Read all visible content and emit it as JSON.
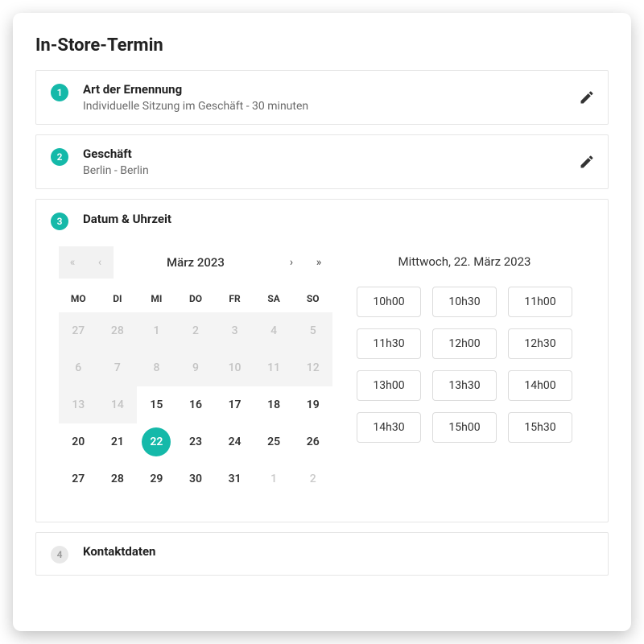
{
  "title": "In-Store-Termin",
  "accent": "#15b9a9",
  "steps": {
    "s1": {
      "num": "1",
      "heading": "Art der Ernennung",
      "sub": "Individuelle Sitzung im Geschäft - 30 minuten"
    },
    "s2": {
      "num": "2",
      "heading": "Geschäft",
      "sub": "Berlin - Berlin"
    },
    "s3": {
      "num": "3",
      "heading": "Datum & Uhrzeit"
    },
    "s4": {
      "num": "4",
      "heading": "Kontaktdaten"
    }
  },
  "calendar": {
    "nav": {
      "first": "«",
      "prev": "‹",
      "next": "›",
      "last": "»"
    },
    "month_label": "März 2023",
    "dow": [
      "MO",
      "DI",
      "MI",
      "DO",
      "FR",
      "SA",
      "SO"
    ],
    "selected_day": "22",
    "rows": [
      [
        {
          "d": "27",
          "t": "muted"
        },
        {
          "d": "28",
          "t": "muted"
        },
        {
          "d": "1",
          "t": "muted"
        },
        {
          "d": "2",
          "t": "muted"
        },
        {
          "d": "3",
          "t": "muted"
        },
        {
          "d": "4",
          "t": "muted"
        },
        {
          "d": "5",
          "t": "muted"
        }
      ],
      [
        {
          "d": "6",
          "t": "muted"
        },
        {
          "d": "7",
          "t": "muted"
        },
        {
          "d": "8",
          "t": "muted"
        },
        {
          "d": "9",
          "t": "muted"
        },
        {
          "d": "10",
          "t": "muted"
        },
        {
          "d": "11",
          "t": "muted"
        },
        {
          "d": "12",
          "t": "muted"
        }
      ],
      [
        {
          "d": "13",
          "t": "muted"
        },
        {
          "d": "14",
          "t": "muted"
        },
        {
          "d": "15",
          "t": "n"
        },
        {
          "d": "16",
          "t": "n"
        },
        {
          "d": "17",
          "t": "n"
        },
        {
          "d": "18",
          "t": "n"
        },
        {
          "d": "19",
          "t": "n"
        }
      ],
      [
        {
          "d": "20",
          "t": "n"
        },
        {
          "d": "21",
          "t": "n"
        },
        {
          "d": "22",
          "t": "sel"
        },
        {
          "d": "23",
          "t": "n"
        },
        {
          "d": "24",
          "t": "n"
        },
        {
          "d": "25",
          "t": "n"
        },
        {
          "d": "26",
          "t": "n"
        }
      ],
      [
        {
          "d": "27",
          "t": "n"
        },
        {
          "d": "28",
          "t": "n"
        },
        {
          "d": "29",
          "t": "n"
        },
        {
          "d": "30",
          "t": "n"
        },
        {
          "d": "31",
          "t": "n"
        },
        {
          "d": "1",
          "t": "out"
        },
        {
          "d": "2",
          "t": "out"
        }
      ]
    ]
  },
  "times": {
    "title": "Mittwoch, 22. März 2023",
    "slots": [
      "10h00",
      "10h30",
      "11h00",
      "11h30",
      "12h00",
      "12h30",
      "13h00",
      "13h30",
      "14h00",
      "14h30",
      "15h00",
      "15h30"
    ]
  }
}
